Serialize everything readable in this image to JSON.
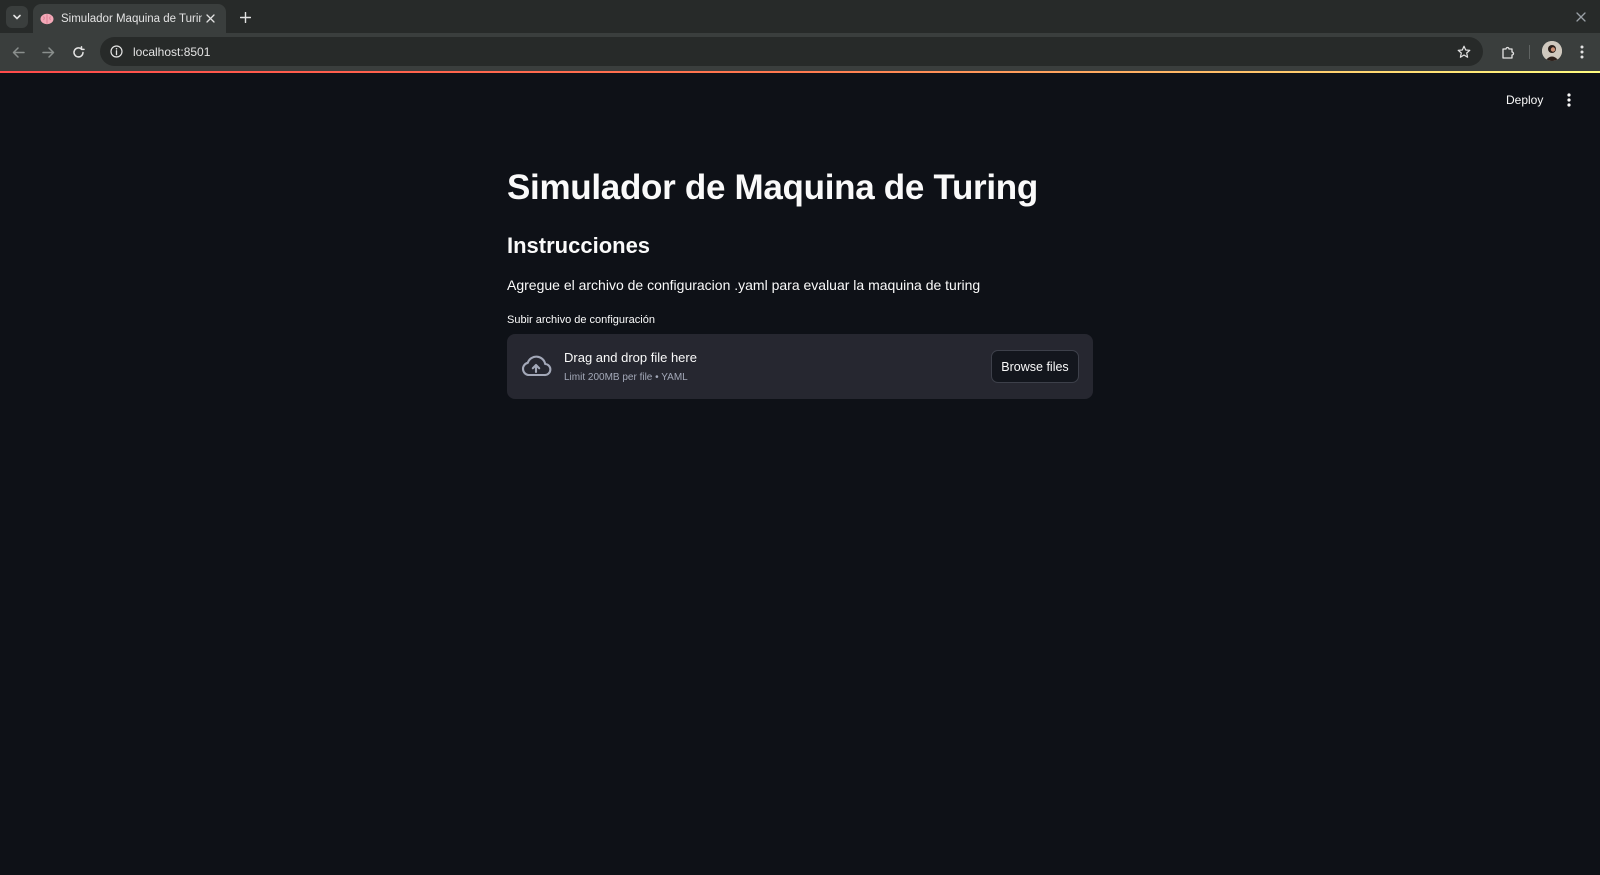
{
  "browser": {
    "tab": {
      "title": "Simulador Maquina de Turing",
      "favicon": "brain-icon"
    },
    "address_bar": {
      "url": "localhost:8501"
    },
    "icons": {
      "tab_search": "chevron-down-icon",
      "tab_close": "close-icon",
      "new_tab": "plus-icon",
      "window_close": "close-icon",
      "back": "arrow-left-icon",
      "forward": "arrow-right-icon",
      "reload": "reload-icon",
      "site_info": "info-icon",
      "bookmark": "star-icon",
      "extensions": "puzzle-icon",
      "profile": "avatar",
      "menu": "kebab-menu-icon"
    }
  },
  "app": {
    "header": {
      "deploy_label": "Deploy",
      "menu_icon": "kebab-menu-icon"
    },
    "title": "Simulador de Maquina de Turing",
    "subheader": "Instrucciones",
    "description": "Agregue el archivo de configuracion .yaml para evaluar la maquina de turing",
    "uploader": {
      "label": "Subir archivo de configuración",
      "dropzone_title": "Drag and drop file here",
      "dropzone_hint": "Limit 200MB per file • YAML",
      "browse_label": "Browse files",
      "icon": "cloud-upload-icon"
    }
  },
  "colors": {
    "background": "#0e1117",
    "dropzone": "#262730",
    "accent_gradient_start": "#ff4b4b",
    "accent_gradient_end": "#fffd80",
    "chrome_dark": "#272a29",
    "chrome_light": "#3a3e3d"
  }
}
